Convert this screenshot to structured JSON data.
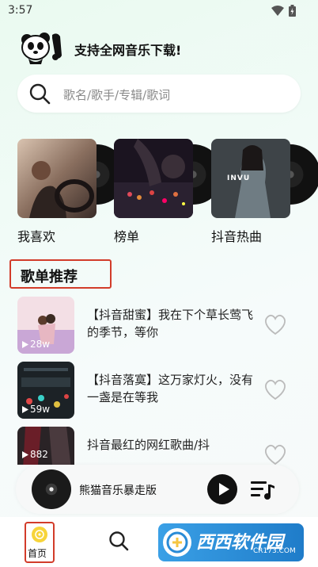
{
  "status": {
    "time": "3:57"
  },
  "header": {
    "slogan": "支持全网音乐下载!"
  },
  "search": {
    "placeholder": "歌名/歌手/专辑/歌词"
  },
  "categories": [
    {
      "label": "我喜欢"
    },
    {
      "label": "榜单"
    },
    {
      "label": "抖音热曲",
      "cover_text": "INVU"
    }
  ],
  "section": {
    "title": "歌单推荐"
  },
  "playlists": [
    {
      "title": "【抖音甜蜜】我在下个草长莺飞的季节，等你",
      "count": "28w"
    },
    {
      "title": "【抖音落寞】这万家灯火，没有一盏是在等我",
      "count": "59w"
    },
    {
      "title": "抖音最红的网红歌曲/抖",
      "count": "882"
    }
  ],
  "player": {
    "title": "熊猫音乐暴走版"
  },
  "nav": {
    "home_label": "首页"
  },
  "watermark": {
    "text": "西西软件园",
    "sub": "CR173.COM"
  },
  "colors": {
    "accent_red": "#d23c2a",
    "home_icon": "#f7d43a",
    "watermark_blue": "#2a8bd6"
  }
}
